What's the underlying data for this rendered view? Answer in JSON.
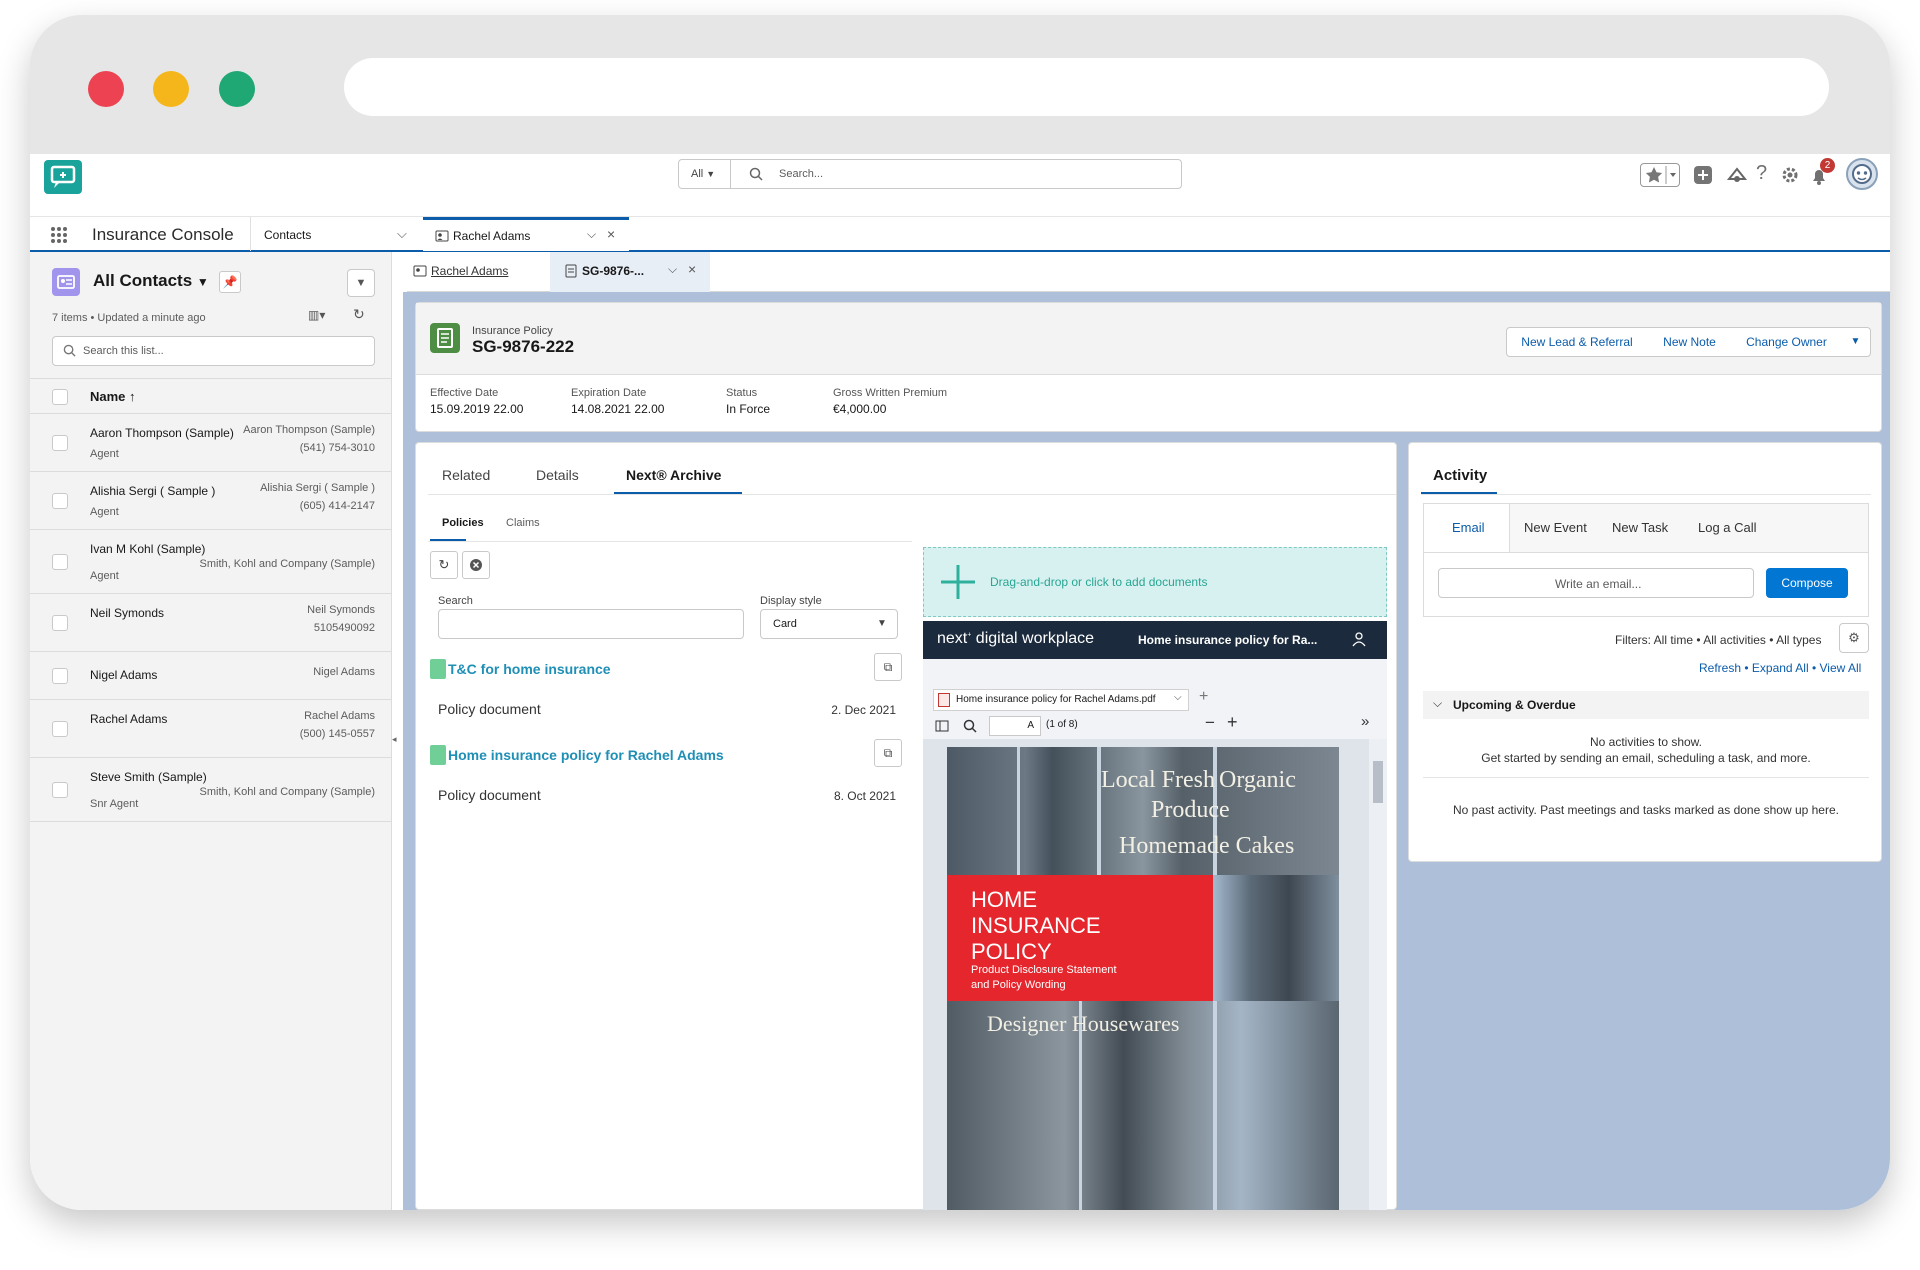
{
  "global_header": {
    "search_scope": "All",
    "search_placeholder": "Search...",
    "notification_count": "2"
  },
  "nav": {
    "app_name": "Insurance Console",
    "object_tab": "Contacts",
    "workspace_tab": "Rachel Adams"
  },
  "subtabs": {
    "tab1": "Rachel Adams",
    "tab2": "SG-9876-..."
  },
  "list_view": {
    "title": "All Contacts",
    "meta": "7 items • Updated a minute ago",
    "search_placeholder": "Search this list...",
    "column_name": "Name",
    "rows": [
      {
        "name": "Aaron Thompson (Sample)",
        "title": "Agent",
        "account": "Aaron Thompson (Sample)",
        "phone": "(541) 754-3010"
      },
      {
        "name": "Alishia Sergi ( Sample )",
        "title": "Agent",
        "account": "Alishia Sergi ( Sample )",
        "phone": "(605) 414-2147"
      },
      {
        "name": "Ivan M Kohl (Sample)",
        "title": "Agent",
        "account": "Smith, Kohl and Company (Sample)",
        "phone": ""
      },
      {
        "name": "Neil Symonds",
        "title": "",
        "account": "Neil Symonds",
        "phone": "5105490092"
      },
      {
        "name": "Nigel Adams",
        "title": "",
        "account": "Nigel Adams",
        "phone": ""
      },
      {
        "name": "Rachel Adams",
        "title": "",
        "account": "Rachel Adams",
        "phone": "(500) 145-0557"
      },
      {
        "name": "Steve Smith (Sample)",
        "title": "Snr Agent",
        "account": "Smith, Kohl and Company (Sample)",
        "phone": ""
      }
    ]
  },
  "record": {
    "object_label": "Insurance Policy",
    "name": "SG-9876-222",
    "actions": [
      "New Lead & Referral",
      "New Note",
      "Change Owner"
    ],
    "fields": [
      {
        "label": "Effective Date",
        "value": "15.09.2019 22.00"
      },
      {
        "label": "Expiration Date",
        "value": "14.08.2021 22.00"
      },
      {
        "label": "Status",
        "value": "In Force"
      },
      {
        "label": "Gross Written Premium",
        "value": "€4,000.00"
      }
    ]
  },
  "tabs": {
    "related": "Related",
    "details": "Details",
    "archive": "Next® Archive"
  },
  "archive": {
    "subtabs": [
      "Policies",
      "Claims"
    ],
    "search_label": "Search",
    "display_label": "Display style",
    "display_value": "Card",
    "documents": [
      {
        "title": "T&C for home insurance",
        "type": "Policy document",
        "date": "2. Dec 2021"
      },
      {
        "title": "Home insurance policy for Rachel Adams",
        "type": "Policy document",
        "date": "8. Oct 2021"
      }
    ],
    "dropzone": "Drag-and-drop or click to add documents",
    "viewer": {
      "brand": "next",
      "brand_tail": "digital workplace",
      "doc_title": "Home insurance policy for Ra...",
      "file_tab": "Home insurance policy for Rachel Adams.pdf",
      "page_input": "A",
      "page_count": "(1 of 8)",
      "cover_heading_1": "HOME",
      "cover_heading_2": "INSURANCE",
      "cover_heading_3": "POLICY",
      "cover_sub_1": "Product Disclosure Statement",
      "cover_sub_2": "and Policy Wording",
      "shop_sign_1": "Local Fresh",
      "shop_sign_2": "Organic",
      "shop_sign_3": "Produce",
      "shop_sign_4": "Homemade Cakes",
      "shop_sign_5": "Designer Housewares"
    }
  },
  "activity": {
    "title": "Activity",
    "tabs": [
      "Email",
      "New Event",
      "New Task",
      "Log a Call"
    ],
    "email_placeholder": "Write an email...",
    "compose": "Compose",
    "filters": "Filters: All time • All activities • All types",
    "links": [
      "Refresh",
      "Expand All",
      "View All"
    ],
    "section": "Upcoming & Overdue",
    "empty_1": "No activities to show.",
    "empty_2": "Get started by sending an email, scheduling a task, and more.",
    "past": "No past activity. Past meetings and tasks marked as done show up here."
  },
  "colors": {
    "brand_teal": "#1aa39a",
    "link_blue": "#0b5cab",
    "compose_blue": "#0176d3",
    "cover_red": "#e5262d",
    "dropzone": "#d6f1ef",
    "viewer_header": "#1b2a3c",
    "workspace_bg": "#aebfda"
  }
}
